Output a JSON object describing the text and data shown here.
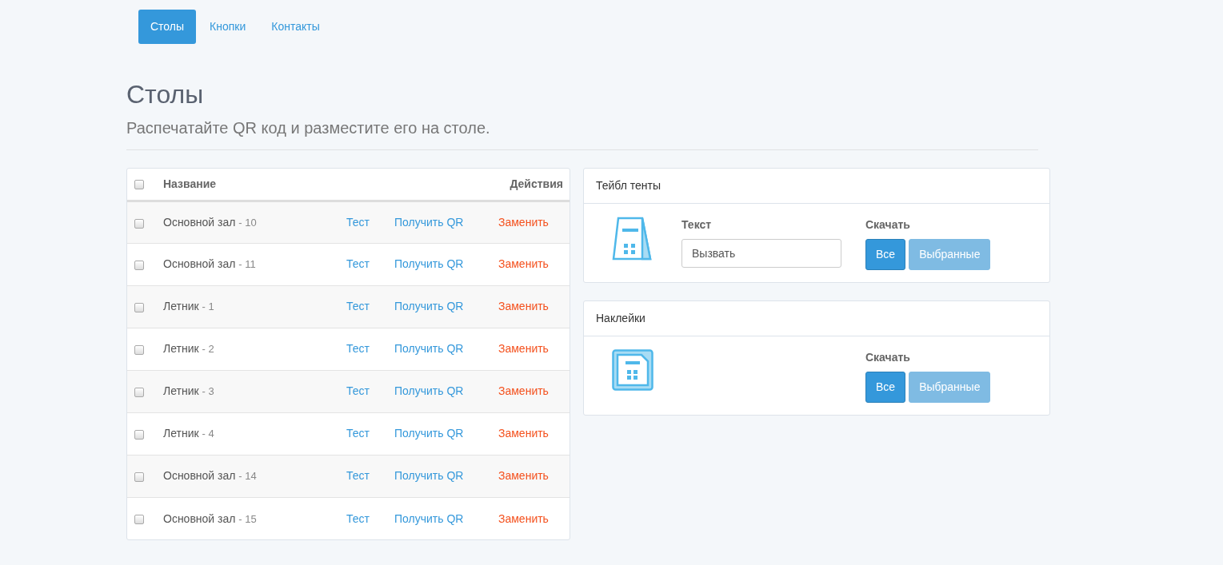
{
  "nav": [
    {
      "label": "Столы",
      "selected": true
    },
    {
      "label": "Кнопки",
      "selected": false
    },
    {
      "label": "Контакты",
      "selected": false
    }
  ],
  "page_title": "Столы",
  "subtitle": "Распечатайте QR код и разместите его на столе.",
  "table": {
    "select_all_checked": false,
    "columns": [
      "Название",
      "Действия"
    ],
    "rows": [
      {
        "name": "Основной зал",
        "number": "- 10",
        "checked": false,
        "actions": [
          "Тест",
          "Получить QR",
          "Заменить"
        ]
      },
      {
        "name": "Основной зал",
        "number": "- 11",
        "checked": false,
        "actions": [
          "Тест",
          "Получить QR",
          "Заменить"
        ]
      },
      {
        "name": "Летник",
        "number": "- 1",
        "checked": false,
        "actions": [
          "Тест",
          "Получить QR",
          "Заменить"
        ]
      },
      {
        "name": "Летник",
        "number": "- 2",
        "checked": false,
        "actions": [
          "Тест",
          "Получить QR",
          "Заменить"
        ]
      },
      {
        "name": "Летник",
        "number": "- 3",
        "checked": false,
        "actions": [
          "Тест",
          "Получить QR",
          "Заменить"
        ]
      },
      {
        "name": "Летник",
        "number": "- 4",
        "checked": false,
        "actions": [
          "Тест",
          "Получить QR",
          "Заменить"
        ]
      },
      {
        "name": "Основной зал",
        "number": "- 14",
        "checked": false,
        "actions": [
          "Тест",
          "Получить QR",
          "Заменить"
        ]
      },
      {
        "name": "Основной зал",
        "number": "- 15",
        "checked": false,
        "actions": [
          "Тест",
          "Получить QR",
          "Заменить"
        ]
      }
    ]
  },
  "panels": [
    {
      "kind": "tent",
      "title": "Тейбл тенты",
      "text_label": "Текст",
      "text_value": "Вызвать",
      "download_label": "Скачать",
      "buttons": [
        {
          "label": "Все",
          "disabled": false
        },
        {
          "label": "Выбранные",
          "disabled": true
        }
      ]
    },
    {
      "kind": "sticker",
      "title": "Наклейки",
      "download_label": "Скачать",
      "buttons": [
        {
          "label": "Все",
          "disabled": false
        },
        {
          "label": "Выбранные",
          "disabled": true
        }
      ]
    }
  ]
}
